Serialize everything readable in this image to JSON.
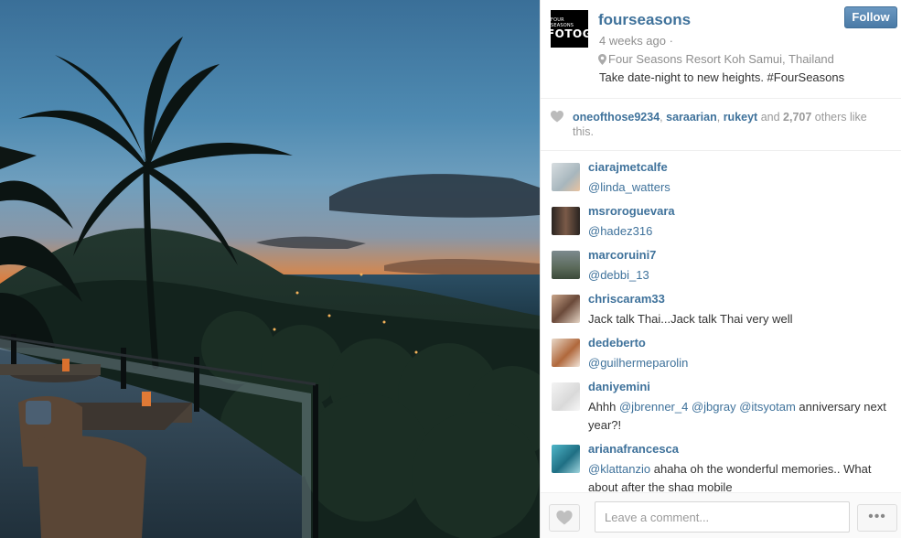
{
  "post": {
    "username": "fourseasons",
    "follow_label": "Follow",
    "time": "4 weeks ago ·",
    "location": "Four Seasons Resort Koh Samui, Thailand",
    "caption": "Take date-night to new heights. #FourSeasons",
    "avatar_text_top": "FOUR SEASONS",
    "avatar_text_bottom": "FOTOG"
  },
  "likes": {
    "user1": "oneofthose9234",
    "sep1": ", ",
    "user2": "saraarian",
    "sep2": ", ",
    "user3": "rukeyt",
    "and": " and ",
    "count": "2,707",
    "tail": " others like this."
  },
  "comments": [
    {
      "user": "ciarajmetcalfe",
      "text": "@linda_watters"
    },
    {
      "user": "msroroguevara",
      "text": "@hadez316"
    },
    {
      "user": "marcoruini7",
      "text": "@debbi_13"
    },
    {
      "user": "chriscaram33",
      "text": "Jack talk Thai...Jack talk Thai very well"
    },
    {
      "user": "dedeberto",
      "text": "@guilhermeparolin"
    },
    {
      "user": "daniyemini",
      "text_pre": "Ahhh ",
      "m1": "@jbrenner_4",
      "m2": "@jbgray",
      "m3": "@itsyotam",
      "text_post": " anniversary next year?!"
    },
    {
      "user": "arianafrancesca",
      "m1": "@klattanzio",
      "text_post": " ahaha oh the wonderful memories.. What about after the shag mobile"
    }
  ],
  "footer": {
    "comment_placeholder": "Leave a comment...",
    "more_label": "•••"
  },
  "icons": {
    "heart": "heart-icon",
    "pin": "location-pin-icon",
    "more": "more-options-icon"
  },
  "colors": {
    "link": "#3f729b",
    "follow_bg": "#5a8bb5",
    "muted": "#8e8e8e"
  }
}
